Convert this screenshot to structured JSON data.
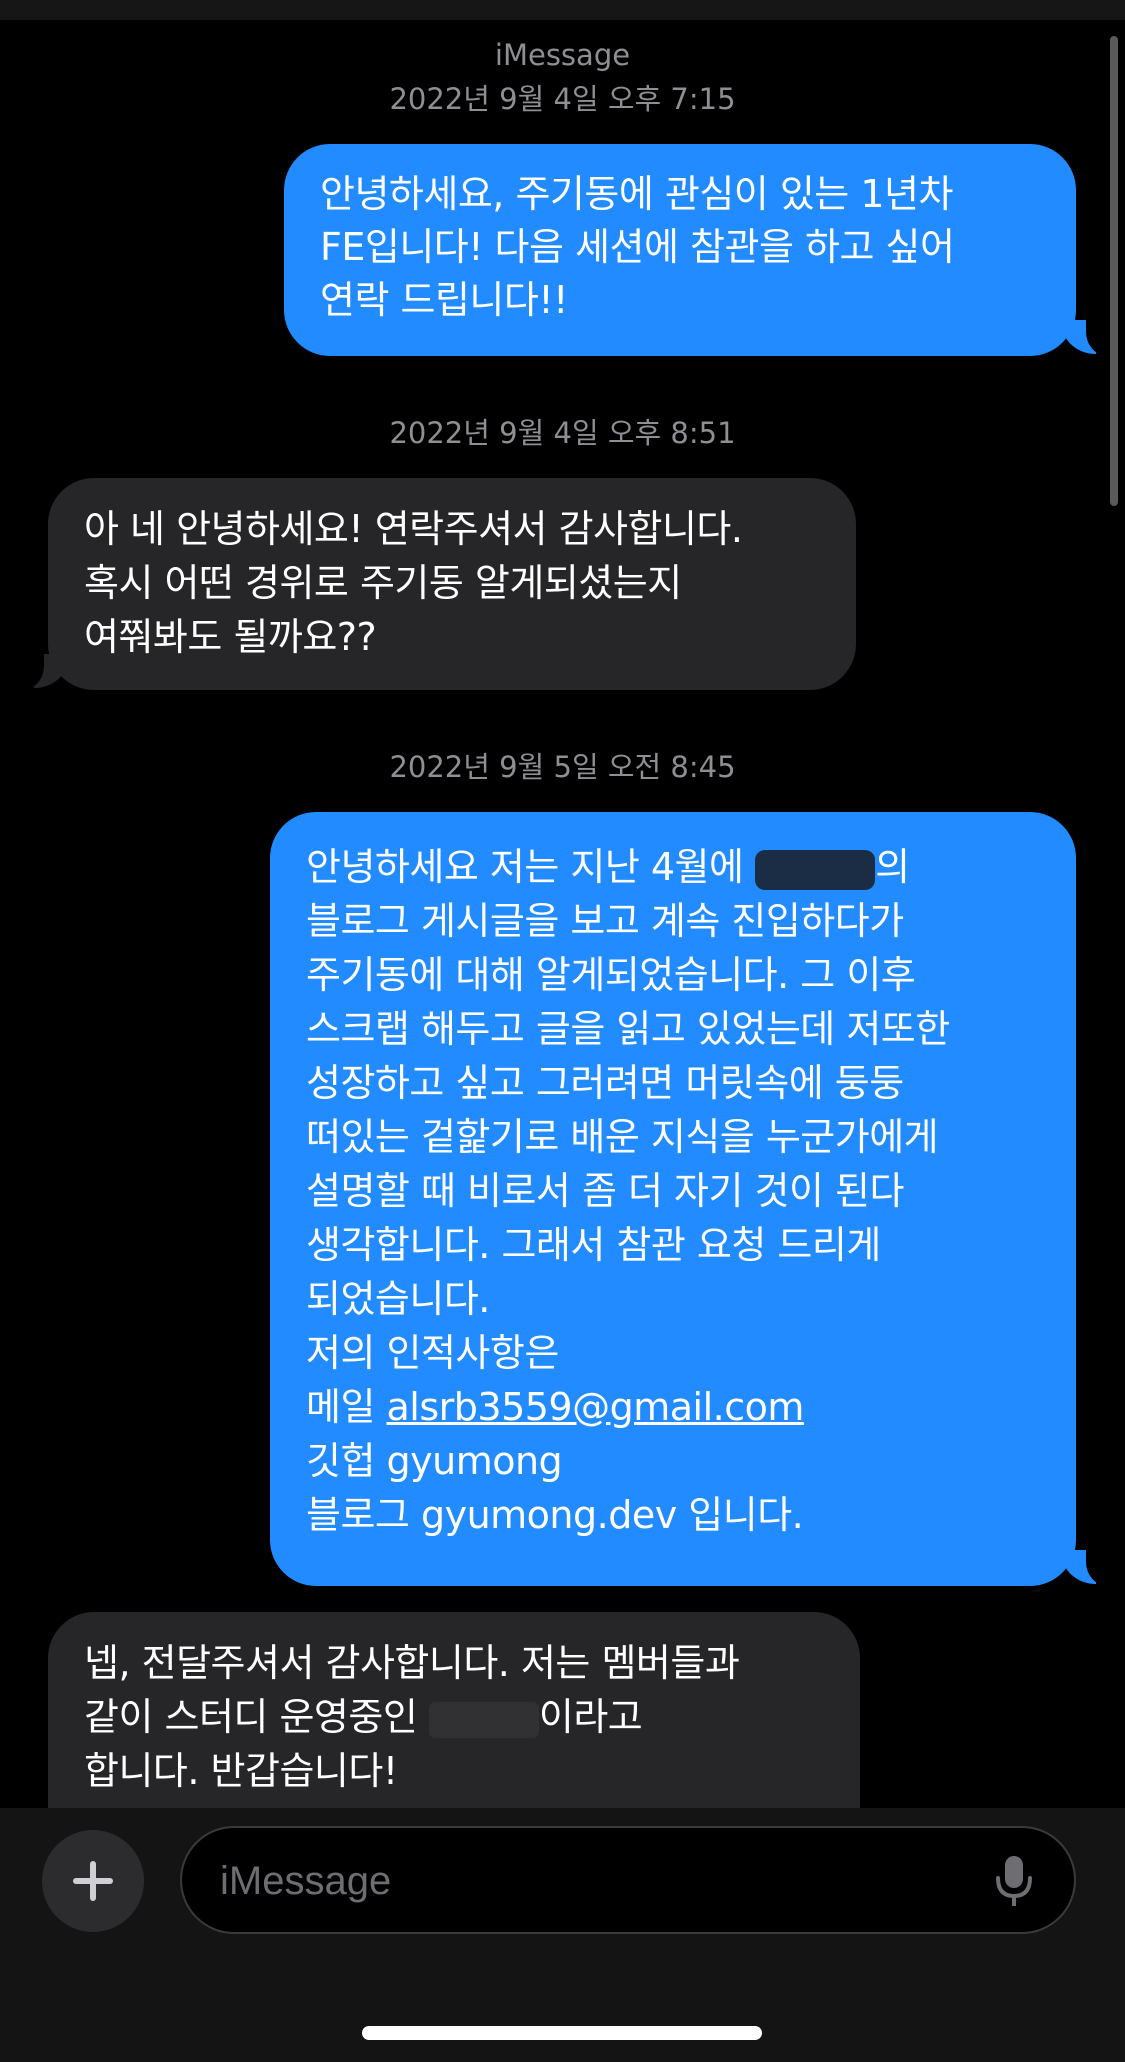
{
  "service_label": "iMessage",
  "messages": [
    {
      "timestamp": "2022년 9월 4일 오후 7:15",
      "direction": "sent",
      "lines": [
        "안녕하세요, 주기동에 관심이 있는 1년차",
        "FE입니다! 다음 세션에 참관을 하고 싶어",
        "연락 드립니다!!"
      ]
    },
    {
      "timestamp": "2022년 9월 4일 오후 8:51",
      "direction": "received",
      "lines": [
        "아 네 안녕하세요! 연락주셔서 감사합니다.",
        "혹시 어떤 경위로 주기동 알게되셨는지",
        "여쭤봐도 될까요??"
      ]
    },
    {
      "timestamp": "2022년 9월 5일 오전 8:45",
      "direction": "sent",
      "line1_prefix": "안녕하세요 저는 지난 4월에 ",
      "line1_suffix": "의",
      "lines": [
        "블로그 게시글을 보고 계속 진입하다가",
        "주기동에 대해 알게되었습니다. 그 이후",
        "스크랩 해두고 글을 읽고 있었는데 저또한",
        "성장하고 싶고 그러려면 머릿속에 둥둥",
        "떠있는 겉핥기로 배운 지식을 누군가에게",
        "설명할 때 비로서 좀 더 자기 것이 된다",
        "생각합니다. 그래서 참관 요청 드리게",
        "되었습니다.",
        "저의 인적사항은"
      ],
      "mail_label": "메일 ",
      "email": "alsrb3559@gmail.com",
      "github_line": "깃헙 gyumong",
      "blog_line": "블로그 gyumong.dev 입니다."
    },
    {
      "direction": "received",
      "lines": [
        "넵, 전달주셔서 감사합니다. 저는 멤버들과"
      ],
      "line2_prefix": "같이 스터디 운영중인 ",
      "line2_suffix": "이라고",
      "line3": "합니다. 반갑습니다!"
    }
  ],
  "composer": {
    "placeholder": "iMessage",
    "add_icon": "plus-icon",
    "mic_icon": "microphone-icon"
  },
  "colors": {
    "sent_bubble": "#218bff",
    "received_bubble": "#262628",
    "background": "#000000",
    "meta_text": "#8e8e93"
  }
}
